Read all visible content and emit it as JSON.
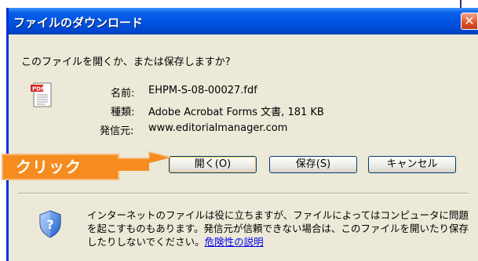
{
  "window": {
    "title": "ファイルのダウンロード",
    "close_glyph": "✕"
  },
  "dialog": {
    "question": "このファイルを開くか、または保存しますか?",
    "icon": "pdf-file-icon",
    "name_label": "名前:",
    "name_value": "EHPM-S-08-00027.fdf",
    "type_label": "種類:",
    "type_value": "Adobe Acrobat Forms 文書, 181 KB",
    "from_label": "発信元:",
    "from_value": "www.editorialmanager.com"
  },
  "buttons": {
    "open": "開く(O)",
    "save": "保存(S)",
    "cancel": "キャンセル"
  },
  "annotation": {
    "label": "クリック",
    "color": "#f68c1f"
  },
  "warning": {
    "icon": "shield-question-icon",
    "text": "インターネットのファイルは役に立ちますが、ファイルによってはコンピュータに問題を起こすものもあります。発信元が信頼できない場合は、このファイルを開いたり保存したりしないでください。",
    "link": "危険性の説明"
  },
  "colors": {
    "titlebar": "#0054e3",
    "dialog_bg": "#ece9d8",
    "link": "#0000ee"
  }
}
